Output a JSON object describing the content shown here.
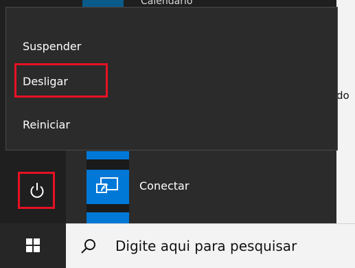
{
  "power_menu": {
    "items": [
      {
        "label": "Suspender"
      },
      {
        "label": "Desligar"
      },
      {
        "label": "Reiniciar"
      }
    ]
  },
  "tiles": {
    "connect_label": "Conectar"
  },
  "background": {
    "right_text_fragment": "do",
    "top_text_fragment": "Calendário"
  },
  "taskbar": {
    "search_placeholder": "Digite aqui para pesquisar"
  },
  "icons": {
    "power": "power-icon",
    "connect": "connect-icon",
    "start": "windows-logo-icon",
    "search": "search-icon"
  },
  "colors": {
    "highlight": "#e81123",
    "tile_accent": "#0078d7",
    "menu_bg": "#2b2b2b"
  }
}
